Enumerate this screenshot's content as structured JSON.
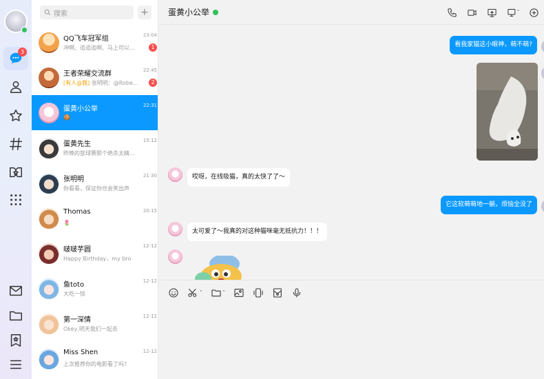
{
  "rail": {
    "chat_badge": "3"
  },
  "conversation_list": {
    "search_placeholder": "搜索",
    "add_label": "+",
    "items": [
      {
        "name": "QQ飞车冠军组",
        "time": "23:04",
        "preview": "冲啊、追追追啊、马上可以...",
        "badge": "1",
        "avatar_color": "#f4a24a"
      },
      {
        "name": "王者荣耀交流群",
        "time": "22:45",
        "mention": "[有人@我]",
        "preview": "张明明：@Robe...",
        "badge": "2",
        "avatar_color": "#c46a3a"
      },
      {
        "name": "蛋黄小公举",
        "time": "22:31",
        "preview": "🍪",
        "avatar_color": "#f6c6d9"
      },
      {
        "name": "蛋黄先生",
        "time": "15:12",
        "preview": "昨晚的篮球赛那个绝杀太精...",
        "avatar_color": "#3a3a3a"
      },
      {
        "name": "张明明",
        "time": "21:30",
        "preview": "你看看，保证你也会笑出声",
        "avatar_color": "#2c3e50"
      },
      {
        "name": "Thomas",
        "time": "20:15",
        "preview": "🌷",
        "avatar_color": "#d08a4a"
      },
      {
        "name": "啵啵芋圆",
        "time": "12-12",
        "preview": "Happy Birthday，my bro",
        "avatar_color": "#7a2e2e"
      },
      {
        "name": "鱼toto",
        "time": "12-12",
        "preview": "大吃一惊",
        "avatar_color": "#7fb6e6"
      },
      {
        "name": "第一深情",
        "time": "12-12",
        "preview": "Okey,明天我们一起去",
        "avatar_color": "#f0c49a"
      },
      {
        "name": "Miss Shen",
        "time": "12-12",
        "preview": "上次推荐你的电影看了吗?",
        "avatar_color": "#6aa6e0"
      }
    ]
  },
  "chat": {
    "title": "蛋黄小公举",
    "messages": {
      "m1": "看我家猫这小眼神，萌不萌?",
      "m2": "哎呀，在线吸猫，真的太快了了～",
      "m3": "它这软萌萌地一躺，烦恼全没了",
      "m4": "太可爱了～我真的对这种猫咪毫无抵抗力！！！"
    }
  },
  "colors": {
    "accent": "#0b99ff",
    "online": "#2fc25b",
    "badge": "#f64f4f"
  }
}
